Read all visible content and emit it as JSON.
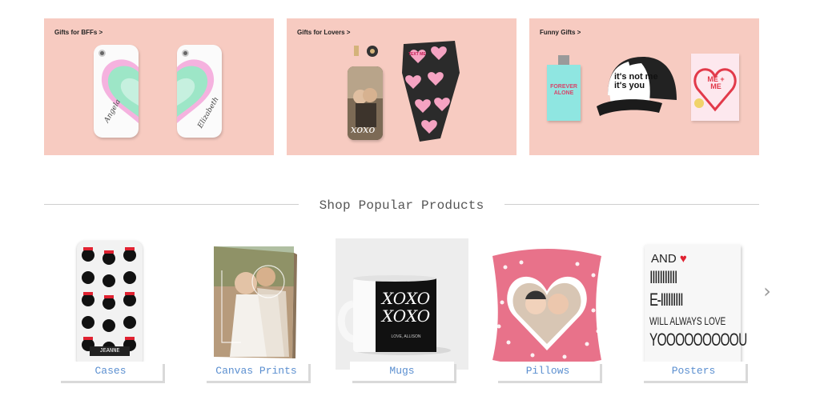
{
  "banners": [
    {
      "label": "Gifts for BFFs >",
      "signature_left": "Angela",
      "signature_right": "Elizabeth"
    },
    {
      "label": "Gifts for Lovers >",
      "photo_text": "xoxo",
      "heart_text": "TEXT ME"
    },
    {
      "label": "Funny Gifts >",
      "flask_text": "FOREVER ALONE",
      "hat_text": "it's not me it's you",
      "card_text": "ME + ME"
    }
  ],
  "section": {
    "title": "Shop Popular Products"
  },
  "products": [
    {
      "label": "Cases",
      "case_name": "JEANNE"
    },
    {
      "label": "Canvas Prints"
    },
    {
      "label": "Mugs",
      "mug_text": "XOXO XOXO",
      "mug_small": "LOVE, ALLISON"
    },
    {
      "label": "Pillows"
    },
    {
      "label": "Posters",
      "poster_lines": [
        "AND ♥",
        "IIIIIIIIIII",
        "E-IIIIIIIII",
        "WILL ALWAYS LOVE",
        "YOOOOOOOOOU"
      ]
    }
  ],
  "carousel": {
    "next_icon": "›"
  },
  "colors": {
    "banner_bg": "#f7cbc1",
    "label_blue": "#5b8fd0",
    "pillow_pink": "#e8728a"
  }
}
